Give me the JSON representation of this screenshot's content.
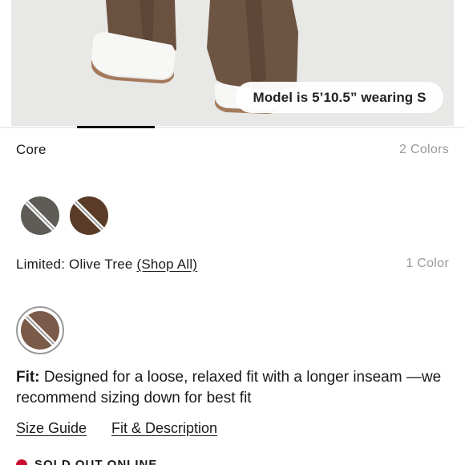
{
  "photo": {
    "model_badge": "Model is 5’10.5” wearing S"
  },
  "core_section": {
    "label": "Core",
    "count": "2 Colors",
    "swatches": [
      {
        "color_name": "grey",
        "color": "#5f5c58"
      },
      {
        "color_name": "brown",
        "color": "#5a3b27"
      }
    ]
  },
  "limited_section": {
    "label": "Limited: Olive Tree",
    "shop_all": "(Shop All)",
    "count": "1 Color",
    "swatches": [
      {
        "color_name": "olive-tree",
        "color": "#7a5a48",
        "selected": true
      }
    ]
  },
  "fit": {
    "label": "Fit:",
    "text": "Designed for a loose, relaxed fit with a longer inseam —we recommend sizing down for best fit"
  },
  "links": {
    "size_guide": "Size Guide",
    "fit_description": "Fit & Description"
  },
  "status": {
    "text": "SOLD OUT ONLINE",
    "color": "#c8102e"
  },
  "carousel": {
    "active_index": 1
  }
}
